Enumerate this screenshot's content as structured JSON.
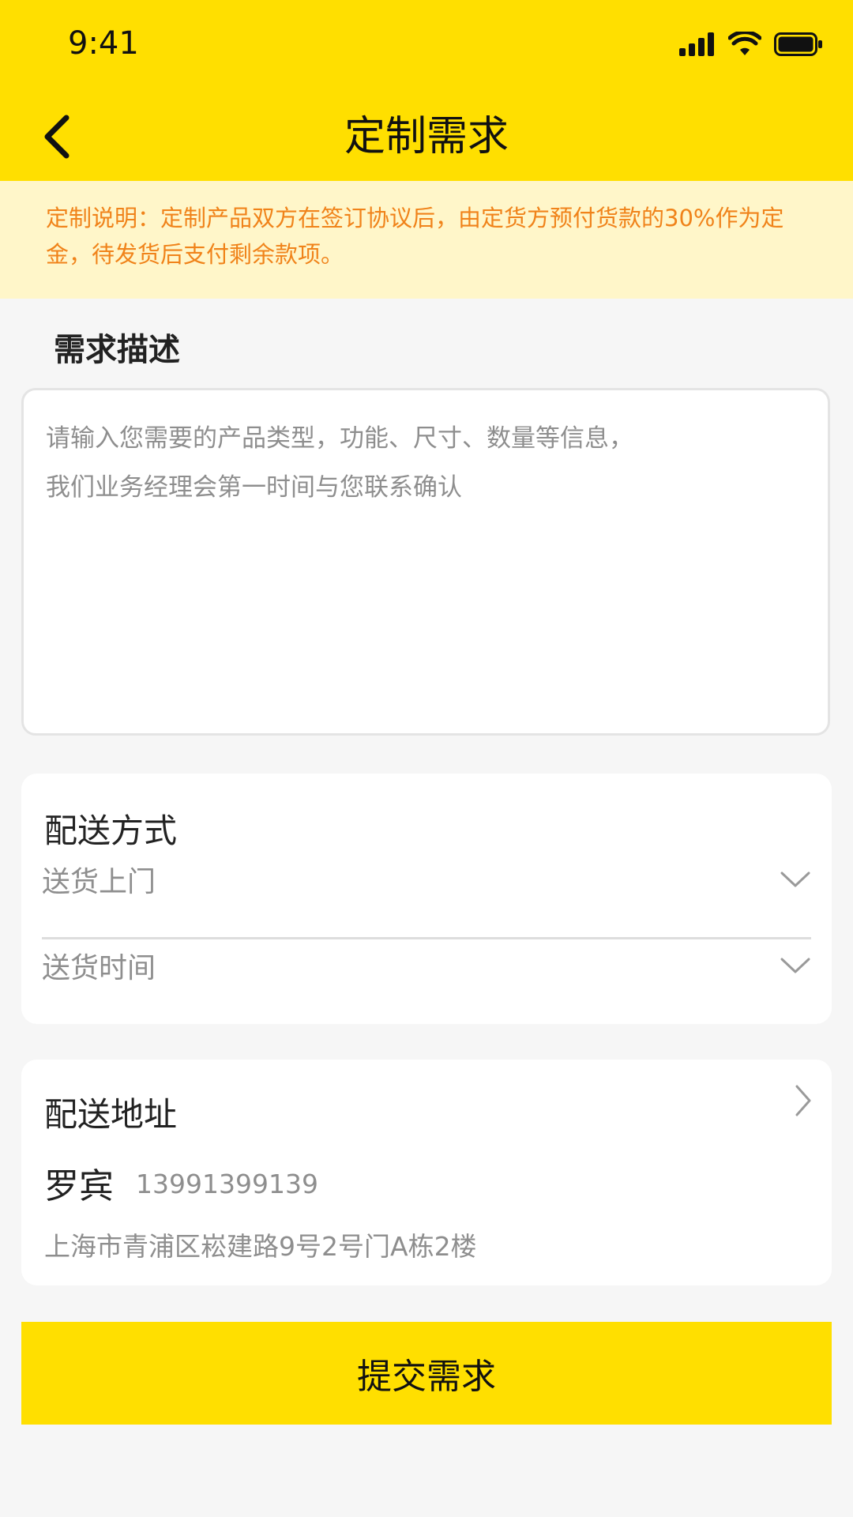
{
  "status_bar": {
    "time": "9:41"
  },
  "header": {
    "title": "定制需求"
  },
  "notice": {
    "text": "定制说明：定制产品双方在签订协议后，由定货方预付货款的30%作为定金，待发货后支付剩余款项。"
  },
  "requirement": {
    "section_title": "需求描述",
    "placeholder_line1": "请输入您需要的产品类型，功能、尺寸、数量等信息，",
    "placeholder_line2": "我们业务经理会第一时间与您联系确认"
  },
  "delivery": {
    "title": "配送方式",
    "method_value": "送货上门",
    "time_placeholder": "送货时间"
  },
  "address": {
    "title": "配送地址",
    "name": "罗宾",
    "phone": "13991399139",
    "detail": "上海市青浦区崧建路9号2号门A栋2楼"
  },
  "actions": {
    "submit_label": "提交需求"
  },
  "colors": {
    "brand_yellow": "#FFDF00",
    "notice_bg": "#FFF6C9",
    "notice_text": "#F0831A"
  }
}
